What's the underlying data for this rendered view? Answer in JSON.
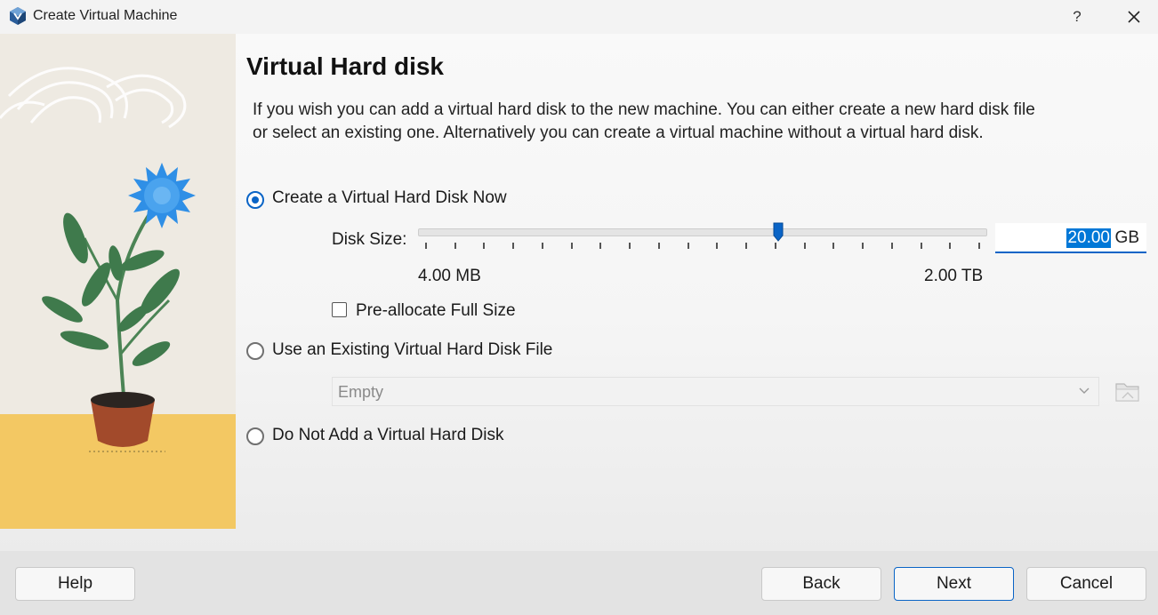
{
  "window": {
    "title": "Create Virtual Machine",
    "help": "?"
  },
  "page": {
    "heading": "Virtual Hard disk",
    "description": "If you wish you can add a virtual hard disk to the new machine. You can either create a new hard disk file or select an existing one. Alternatively you can create a virtual machine without a virtual hard disk."
  },
  "options": {
    "create_now": {
      "label": "Create a Virtual Hard Disk Now",
      "checked": true
    },
    "use_existing": {
      "label": "Use an Existing Virtual Hard Disk File",
      "checked": false
    },
    "do_not_add": {
      "label": "Do Not Add a Virtual Hard Disk",
      "checked": false
    }
  },
  "disk_size": {
    "label": "Disk Size:",
    "value": "20.00",
    "unit": "GB",
    "min_label": "4.00 MB",
    "max_label": "2.00 TB",
    "slider_fraction": 0.635
  },
  "preallocate": {
    "label": "Pre-allocate Full Size",
    "checked": false
  },
  "existing_disk": {
    "selected": "Empty"
  },
  "footer": {
    "help": "Help",
    "back": "Back",
    "next": "Next",
    "cancel": "Cancel"
  },
  "colors": {
    "accent": "#0a64c6",
    "selection": "#0078d7",
    "floor": "#f3c863",
    "flower": "#2f8fe6",
    "leaf": "#3f7a4c",
    "pot": "#a24a2b"
  }
}
